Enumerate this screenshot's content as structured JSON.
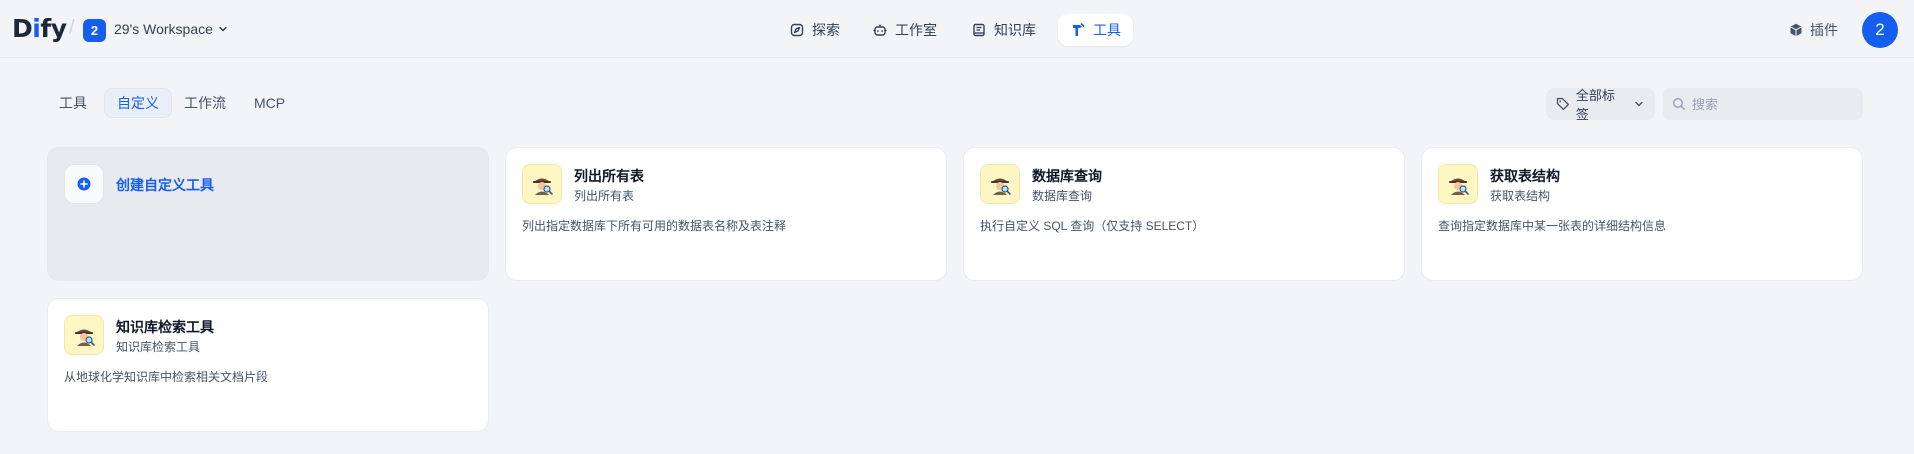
{
  "app": {
    "logo_prefix": "D",
    "logo_i": "i",
    "logo_suffix": "fy",
    "workspace_badge": "2",
    "workspace_name": "29's Workspace",
    "avatar_initial": "2",
    "brand_color": "#155eef"
  },
  "nav": {
    "items": [
      {
        "label": "探索",
        "icon": "compass-icon"
      },
      {
        "label": "工作室",
        "icon": "robot-icon"
      },
      {
        "label": "知识库",
        "icon": "book-icon"
      },
      {
        "label": "工具",
        "icon": "hammer-icon",
        "active": true
      }
    ],
    "plugins_label": "插件"
  },
  "tabs": [
    {
      "label": "工具"
    },
    {
      "label": "自定义",
      "active": true
    },
    {
      "label": "工作流"
    },
    {
      "label": "MCP"
    }
  ],
  "filters": {
    "tag_label": "全部标签",
    "search_placeholder": "搜索",
    "search_value": ""
  },
  "create_card": {
    "label": "创建自定义工具"
  },
  "tools": [
    {
      "title": "列出所有表",
      "subtitle": "列出所有表",
      "description": "列出指定数据库下所有可用的数据表名称及表注释",
      "icon": "detective-icon"
    },
    {
      "title": "数据库查询",
      "subtitle": "数据库查询",
      "description": "执行自定义 SQL 查询（仅支持 SELECT）",
      "icon": "detective-icon"
    },
    {
      "title": "获取表结构",
      "subtitle": "获取表结构",
      "description": "查询指定数据库中某一张表的详细结构信息",
      "icon": "detective-icon"
    },
    {
      "title": "知识库检索工具",
      "subtitle": "知识库检索工具",
      "description": "从地球化学知识库中检索相关文档片段",
      "icon": "detective-icon"
    }
  ]
}
